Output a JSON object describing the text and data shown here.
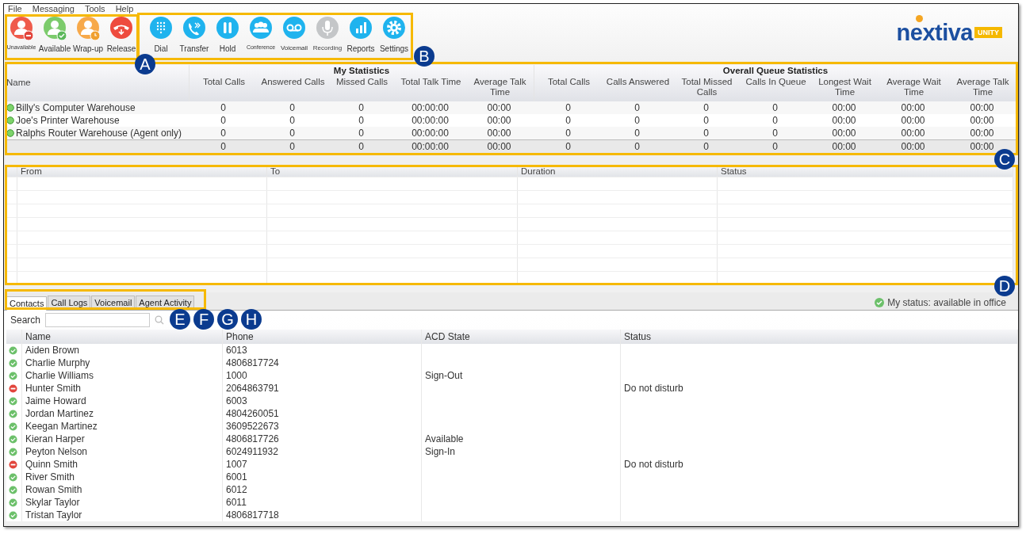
{
  "menu": [
    "File",
    "Messaging",
    "Tools",
    "Help"
  ],
  "status_buttons": [
    {
      "label": "Unavailable",
      "kind": "unavailable"
    },
    {
      "label": "Available",
      "kind": "available"
    },
    {
      "label": "Wrap-up",
      "kind": "wrapup"
    },
    {
      "label": "Release",
      "kind": "release"
    }
  ],
  "call_buttons": [
    {
      "label": "Dial",
      "kind": "dial",
      "disabled": false
    },
    {
      "label": "Transfer",
      "kind": "transfer",
      "disabled": false
    },
    {
      "label": "Hold",
      "kind": "hold",
      "disabled": false
    },
    {
      "label": "Conference",
      "kind": "conference",
      "disabled": false
    },
    {
      "label": "Voicemail",
      "kind": "voicemail",
      "disabled": false
    },
    {
      "label": "Recording",
      "kind": "recording",
      "disabled": true
    },
    {
      "label": "Reports",
      "kind": "reports",
      "disabled": false
    },
    {
      "label": "Settings",
      "kind": "settings",
      "disabled": false
    }
  ],
  "logo": {
    "name": "nextiva",
    "badge": "UNITY"
  },
  "stats": {
    "name_header": "Name",
    "groups": [
      {
        "title": "My Statistics",
        "columns": [
          "Total Calls",
          "Answered Calls",
          "Missed Calls",
          "Total Talk Time",
          "Average Talk Time"
        ]
      },
      {
        "title": "Overall Queue Statistics",
        "columns": [
          "Total Calls",
          "Calls Answered",
          "Total Missed Calls",
          "Calls In Queue",
          "Longest Wait Time",
          "Average Wait Time",
          "Average Talk Time"
        ]
      }
    ],
    "rows": [
      {
        "name": "Billy's Computer Warehouse",
        "values": [
          "0",
          "0",
          "0",
          "00:00:00",
          "00:00",
          "0",
          "0",
          "0",
          "0",
          "00:00",
          "00:00",
          "00:00"
        ]
      },
      {
        "name": "Joe's Printer Warehouse",
        "values": [
          "0",
          "0",
          "0",
          "00:00:00",
          "00:00",
          "0",
          "0",
          "0",
          "0",
          "00:00",
          "00:00",
          "00:00"
        ]
      },
      {
        "name": "Ralphs Router Warehouse (Agent only)",
        "values": [
          "0",
          "0",
          "0",
          "00:00:00",
          "00:00",
          "0",
          "0",
          "0",
          "0",
          "00:00",
          "00:00",
          "00:00"
        ]
      }
    ],
    "totals": [
      "0",
      "0",
      "0",
      "00:00:00",
      "00:00",
      "0",
      "0",
      "0",
      "0",
      "00:00",
      "00:00",
      "00:00"
    ]
  },
  "calls": {
    "columns": [
      "From",
      "To",
      "Duration",
      "Status"
    ]
  },
  "tabs": [
    {
      "label": "Contacts",
      "selected": true
    },
    {
      "label": "Call Logs",
      "selected": false
    },
    {
      "label": "Voicemail",
      "selected": false
    },
    {
      "label": "Agent Activity",
      "selected": false
    }
  ],
  "my_status": "My status: available in office",
  "search": {
    "label": "Search"
  },
  "contacts": {
    "columns": [
      "Name",
      "Phone",
      "ACD State",
      "Status"
    ],
    "rows": [
      {
        "available": true,
        "name": "Aiden Brown",
        "phone": "6013"
      },
      {
        "available": true,
        "name": "Charlie Murphy",
        "phone": "4806817724"
      },
      {
        "available": true,
        "name": "Charlie Williams",
        "phone": "1000",
        "acd_state": "Sign-Out"
      },
      {
        "available": false,
        "name": "Hunter Smith",
        "phone": "2064863791",
        "status": "Do not disturb"
      },
      {
        "available": true,
        "name": "Jaime Howard",
        "phone": "6003"
      },
      {
        "available": true,
        "name": "Jordan Martinez",
        "phone": "4804260051"
      },
      {
        "available": true,
        "name": "Keegan Martinez",
        "phone": "3609522673"
      },
      {
        "available": true,
        "name": "Kieran Harper",
        "phone": "4806817726",
        "acd_state": "Available"
      },
      {
        "available": true,
        "name": "Peyton Nelson",
        "phone": "6024911932",
        "acd_state": "Sign-In"
      },
      {
        "available": false,
        "name": "Quinn Smith",
        "phone": "1007",
        "status": "Do not disturb"
      },
      {
        "available": true,
        "name": "River Smith",
        "phone": "6001"
      },
      {
        "available": true,
        "name": "Rowan Smith",
        "phone": "6012"
      },
      {
        "available": true,
        "name": "Skylar Taylor",
        "phone": "6011"
      },
      {
        "available": true,
        "name": "Tristan Taylor",
        "phone": "4806817718"
      }
    ]
  },
  "callouts": [
    {
      "label": "A"
    },
    {
      "label": "B"
    },
    {
      "label": "C"
    },
    {
      "label": "D"
    },
    {
      "label": "E"
    },
    {
      "label": "F"
    },
    {
      "label": "G"
    },
    {
      "label": "H"
    }
  ]
}
